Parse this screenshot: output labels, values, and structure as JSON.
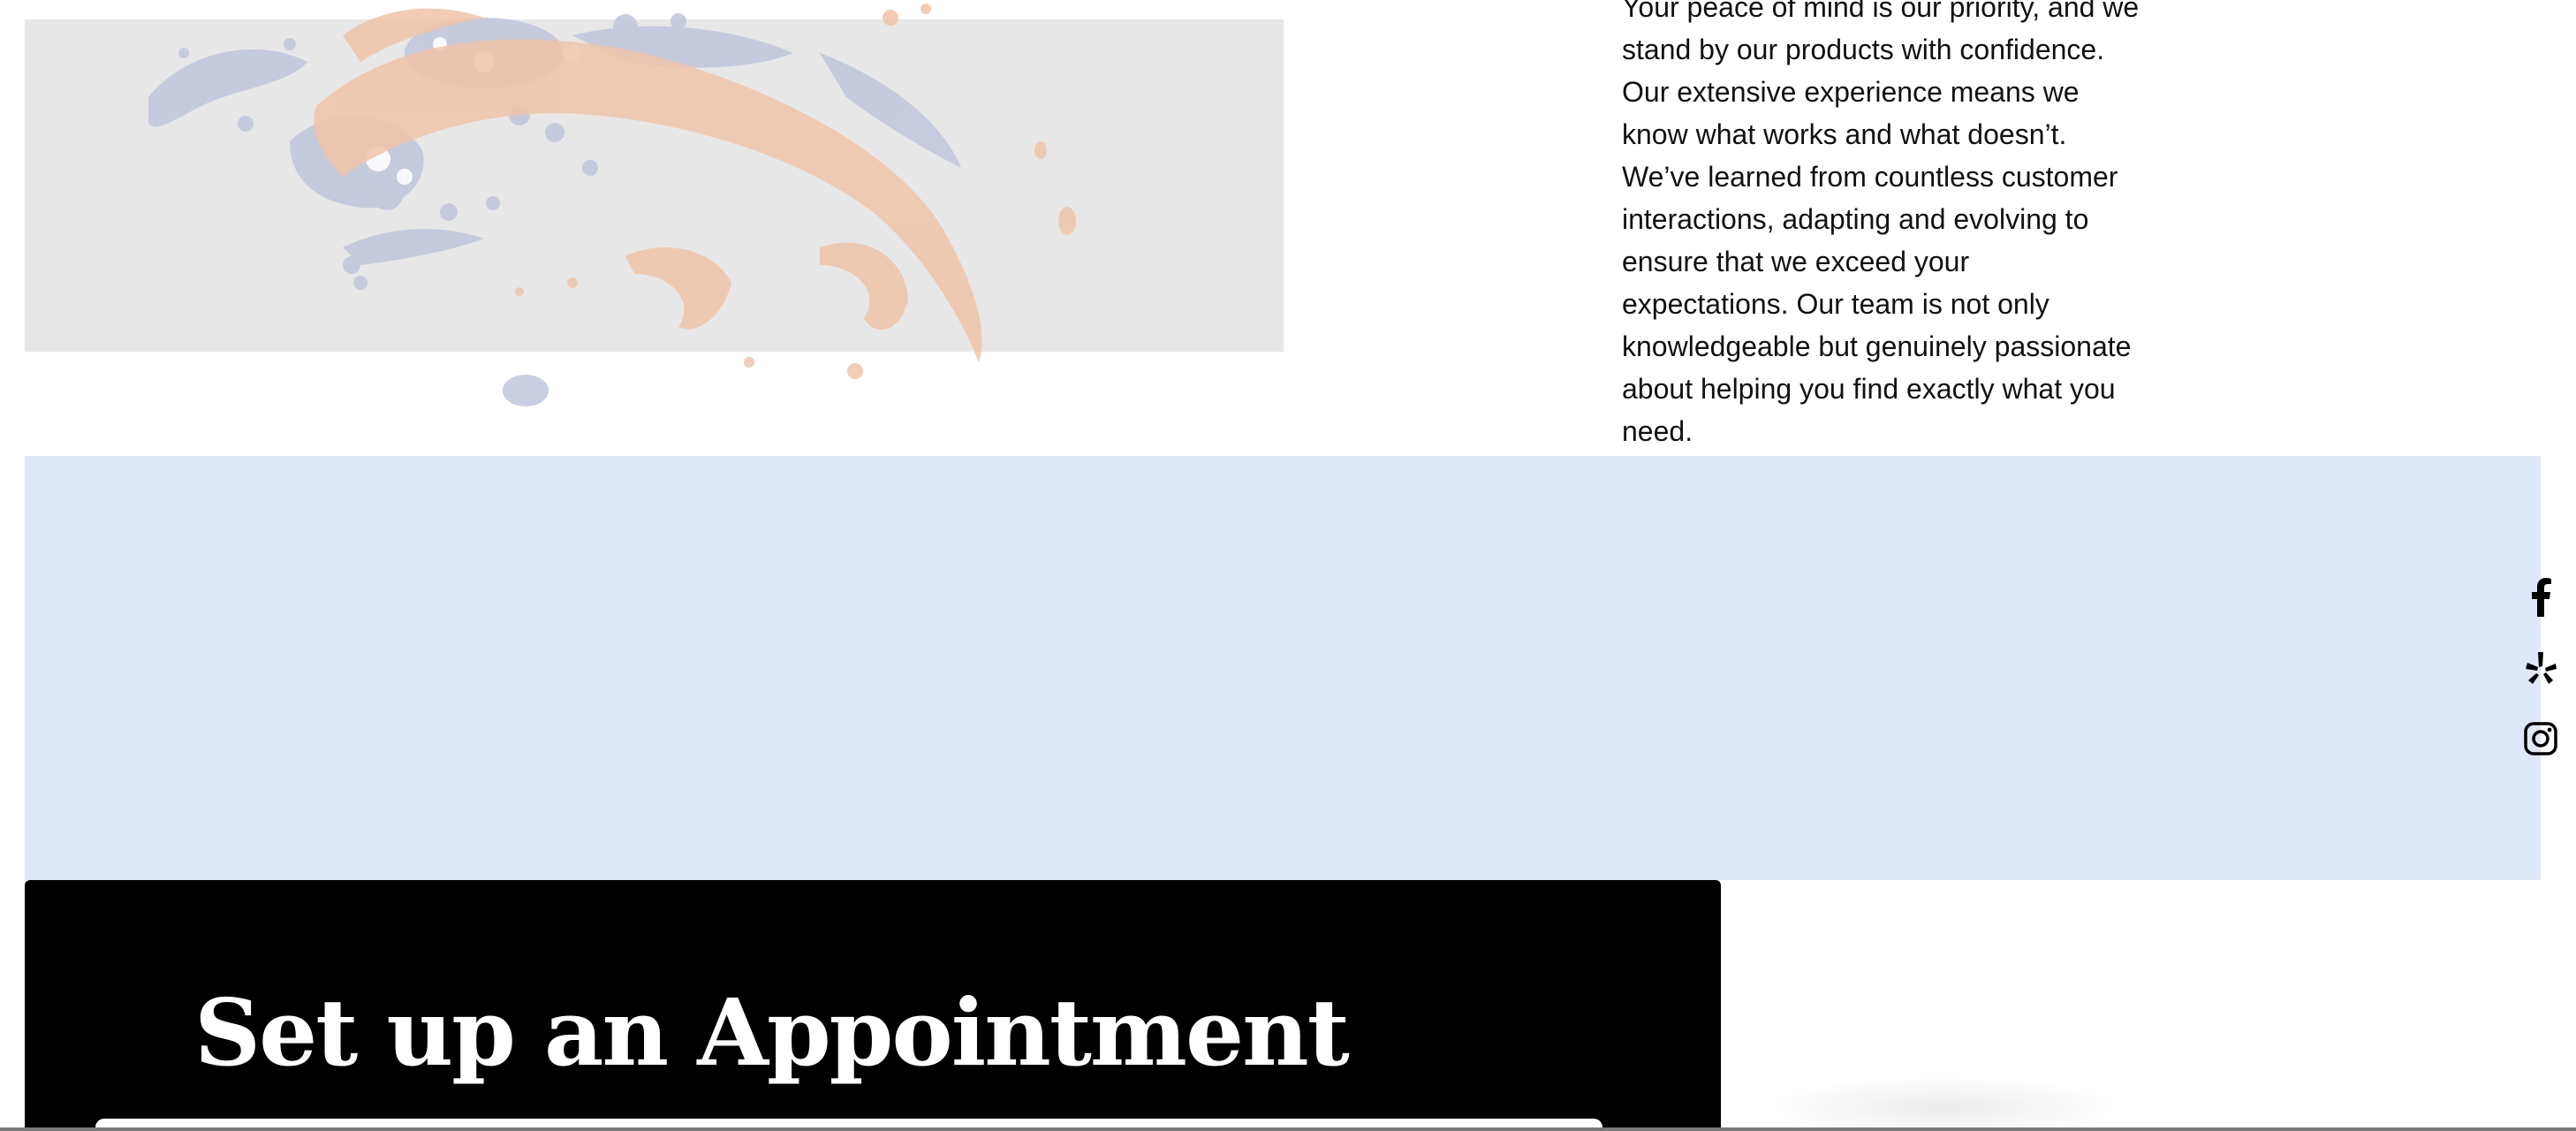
{
  "about": {
    "paragraph": "Your peace of mind is our priority, and we stand by our products with confidence. Our extensive experience means we know what works and what doesn’t. We’ve learned from countless customer interactions, adapting and evolving to ensure that we exceed your expectations. Our team is not only knowledgeable but genuinely passionate about helping you find exactly what you need."
  },
  "social": {
    "items": [
      {
        "name": "facebook",
        "icon": "facebook-icon"
      },
      {
        "name": "yelp",
        "icon": "yelp-icon"
      },
      {
        "name": "instagram",
        "icon": "instagram-icon"
      }
    ]
  },
  "appointment": {
    "title": "Set up an Appointment"
  },
  "colors": {
    "band": "#dee8f8",
    "card": "#000000",
    "splash_orange": "#f2c7ad",
    "splash_blue": "#b7bfd9"
  }
}
